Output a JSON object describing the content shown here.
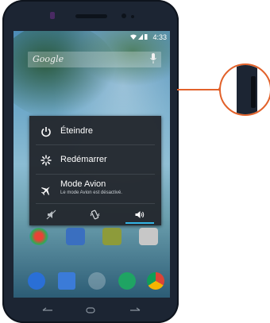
{
  "status_bar": {
    "time": "4:33",
    "icons": [
      "wifi-icon",
      "signal-icon",
      "battery-icon"
    ]
  },
  "search": {
    "label": "Google",
    "icon": "mic-icon"
  },
  "power_menu": {
    "items": [
      {
        "label": "Éteindre",
        "icon": "power-icon"
      },
      {
        "label": "Redémarrer",
        "icon": "restart-icon"
      },
      {
        "label": "Mode Avion",
        "sublabel": "Le mode Avion est désactivé.",
        "icon": "airplane-icon"
      }
    ],
    "sound_modes": [
      {
        "icon": "silent-icon",
        "active": false
      },
      {
        "icon": "vibrate-icon",
        "active": false
      },
      {
        "icon": "sound-on-icon",
        "active": true
      }
    ]
  },
  "colors": {
    "accent": "#33b5e5",
    "callout": "#e2622b",
    "menu_bg": "#23282e",
    "phone_body": "#1c2533"
  }
}
